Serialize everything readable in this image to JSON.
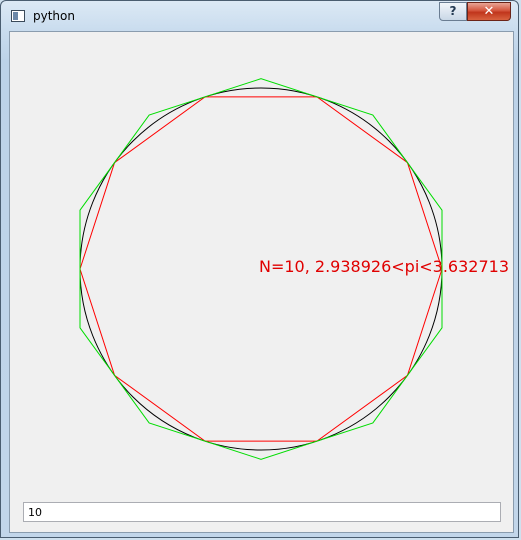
{
  "window": {
    "title": "python"
  },
  "titlebar": {
    "help_label": "?",
    "close_label": "✕"
  },
  "colors": {
    "circle": "#000000",
    "inscribed": "#ff0000",
    "circumscribed": "#00dd00",
    "estimate_text": "#e00000"
  },
  "plot": {
    "n_sides": 10,
    "estimate_text": "N=10, 2.938926<pi<3.632713"
  },
  "input": {
    "value": "10"
  }
}
